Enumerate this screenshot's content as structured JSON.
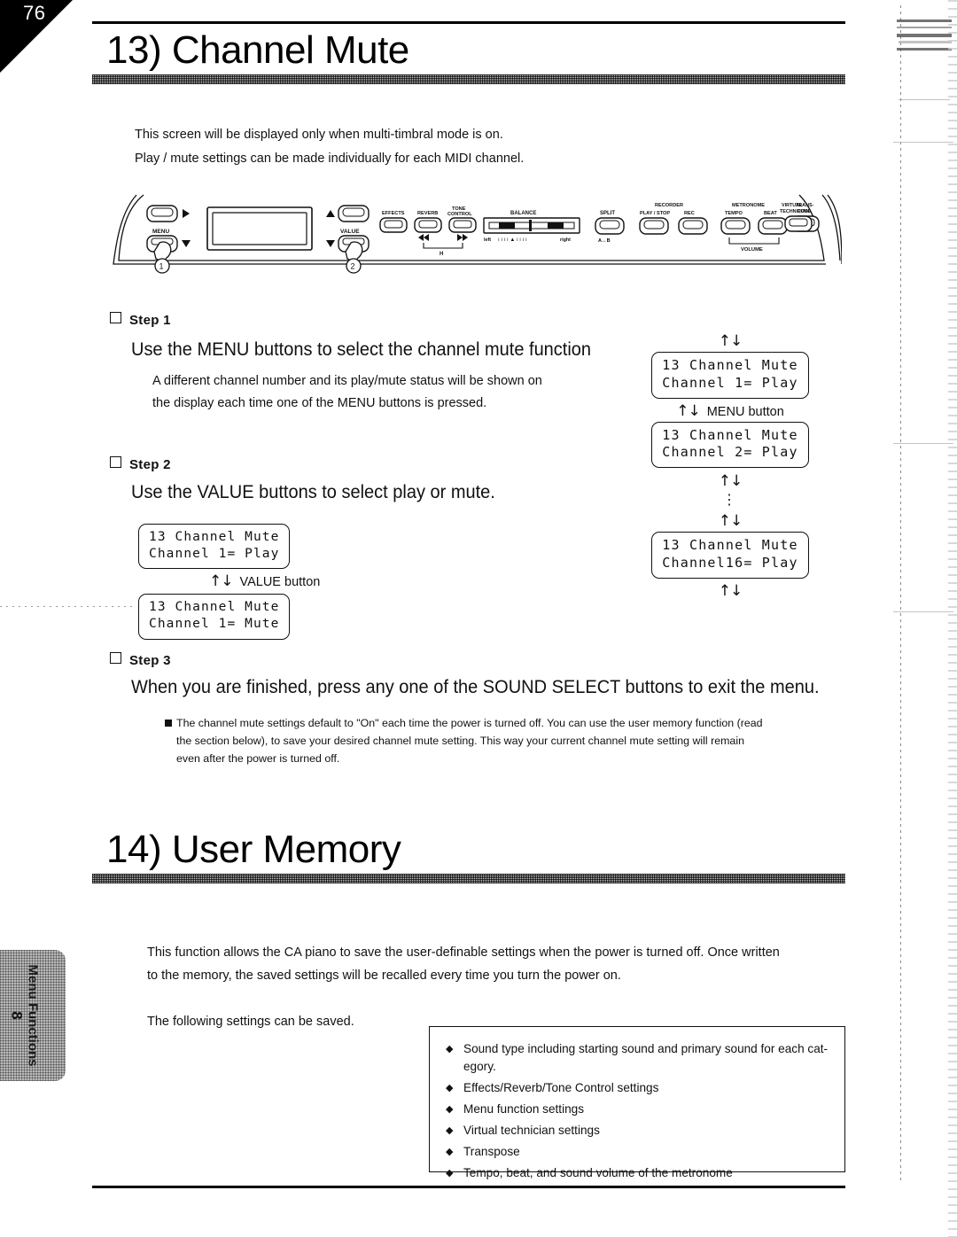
{
  "page": {
    "number": "76",
    "side_tab_label": "Menu Functions",
    "side_tab_number": "8"
  },
  "section_13": {
    "heading": "13) Channel Mute",
    "intro_line_1": "This screen will be displayed only when multi-timbral mode is on.",
    "intro_line_2": "Play / mute settings can be made individually for each MIDI channel.",
    "panel": {
      "menu_label": "MENU",
      "value_label": "VALUE",
      "callout_1": "①",
      "callout_2": "②",
      "effects_label": "EFFECTS",
      "reverb_label": "REVERB",
      "tone_control_label": "TONE\nCONTROL",
      "rewind_icon": "◀◀",
      "forward_icon": "▶▶",
      "transport_mark": "H",
      "balance_label": "BALANCE",
      "balance_left": "left",
      "balance_right": "right",
      "split_label": "SPLIT",
      "split_sub": "A↔B",
      "recorder_label": "RECORDER",
      "play_stop_label": "PLAY / STOP",
      "rec_label": "REC",
      "metronome_label": "METRONOME",
      "tempo_label": "TEMPO",
      "beat_label": "BEAT",
      "volume_label": "VOLUME",
      "transpose_label": "TRANS-\nPOSE",
      "virtual_technician_label": "VIRTUAL\nTECHNICIAN",
      "up_arrow": "▲",
      "down_arrow": "▼"
    },
    "step1": {
      "label": "Step 1",
      "title": "Use the MENU buttons to select the channel mute function",
      "body_line_1": "A different channel number and its play/mute status will be shown on",
      "body_line_2": "the display each time one of the MENU buttons is pressed."
    },
    "step2": {
      "label": "Step 2",
      "title": "Use the VALUE buttons to select play or mute."
    },
    "step3": {
      "label": "Step 3",
      "title": "When you are finished, press any one of the SOUND SELECT buttons to exit the menu."
    },
    "menu_flow": {
      "arrows_top": "↑↓",
      "arrows_mid": "↑↓",
      "arrows_mid2": "↑↓",
      "arrows_bottom": "↑↓",
      "button_label": "MENU button",
      "ellipsis": "⋮",
      "lcd_1_line_1": "13 Channel Mute",
      "lcd_1_line_2": "Channel 1= Play",
      "lcd_2_line_1": "13 Channel Mute",
      "lcd_2_line_2": "Channel 2= Play",
      "lcd_3_line_1": "13 Channel Mute",
      "lcd_3_line_2": "Channel16= Play"
    },
    "value_flow": {
      "arrows": "↑↓",
      "button_label": "VALUE button",
      "lcd_1_line_1": "13 Channel Mute",
      "lcd_1_line_2": "Channel 1= Play",
      "lcd_2_line_1": "13 Channel Mute",
      "lcd_2_line_2": "Channel 1= Mute"
    },
    "note": {
      "bullet": "■",
      "line_1": "The channel mute settings default to \"On\" each time the power is turned off. You can use the user memory function (read",
      "line_2": "the section below), to save your desired channel mute setting. This way your current channel mute setting will remain",
      "line_3": "even after the power is turned off."
    }
  },
  "section_14": {
    "heading": "14) User Memory",
    "body_line_1": "This function allows the CA piano to save the user-definable settings when the power is turned off. Once written",
    "body_line_2": "to the memory, the saved settings will be recalled every time you turn the power on.",
    "body_line_3": "The following settings can be saved.",
    "list_bullet": "◆",
    "list": [
      "Sound type including starting sound and primary sound for each cat-",
      "egory.",
      "Effects/Reverb/Tone Control settings",
      "Menu function settings",
      "Virtual technician settings",
      "Transpose",
      "Tempo, beat, and sound volume of the metronome"
    ]
  },
  "colors": {
    "ink": "#111111",
    "halftone": "#cfcfcf",
    "tab_gray": "#b9b9b9"
  }
}
